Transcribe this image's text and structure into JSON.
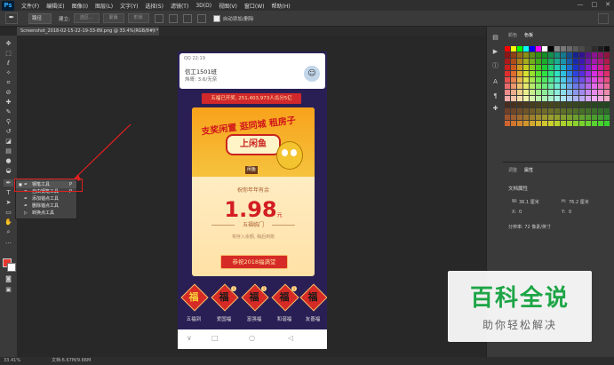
{
  "app": {
    "logo": "Ps"
  },
  "menubar": {
    "items": [
      "文件(F)",
      "编辑(E)",
      "图像(I)",
      "图层(L)",
      "文字(Y)",
      "选择(S)",
      "滤镜(T)",
      "3D(D)",
      "视图(V)",
      "窗口(W)",
      "帮助(H)"
    ],
    "window_controls": [
      "—",
      "□",
      "✕"
    ]
  },
  "optionsbar": {
    "mode": "路径",
    "make_label": "建立:",
    "selection_btn": "选区...",
    "mask_btn": "蒙版",
    "shape_btn": "形状",
    "auto_add_delete": "自动添加/删除"
  },
  "document": {
    "tab_title": "Screenshot_2018-02-15-22-19-33-89.png @ 33.4%(RGB/8#) *",
    "close": "×"
  },
  "status": {
    "zoom": "33.41%",
    "doc_info": "文档:6.67M/9.66M"
  },
  "context_menu": {
    "items": [
      {
        "label": "钢笔工具",
        "shortcut": "P",
        "selected": true
      },
      {
        "label": "自由钢笔工具",
        "shortcut": "P",
        "selected": false
      },
      {
        "label": "添加锚点工具",
        "shortcut": "",
        "selected": false
      },
      {
        "label": "删除锚点工具",
        "shortcut": "",
        "selected": false
      },
      {
        "label": "转换点工具",
        "shortcut": "",
        "selected": false
      }
    ]
  },
  "phone": {
    "notification": {
      "app": "QQ 22:19",
      "title": "信工1501班",
      "subtitle": "炜哥: 3.6/无奈"
    },
    "banner": "五福已开奖, 251,403,973人瓜分5亿",
    "card": {
      "slogan": "支奖闲置 逛同城 租房子",
      "brand": "上闲鱼",
      "logo": "闲鱼",
      "total_label": "祝你年年有余",
      "amount": "1.98",
      "amount_unit": "元",
      "subtitle": "五福临门",
      "note": "将存入余额, 稍后到账",
      "button": "恭祝2018福满堂"
    },
    "fu_cards": [
      {
        "char": "福",
        "name": "五福到",
        "gold": true
      },
      {
        "char": "福",
        "name": "爱国福",
        "gold": false
      },
      {
        "char": "福",
        "name": "富强福",
        "gold": false
      },
      {
        "char": "福",
        "name": "和谐福",
        "gold": false
      },
      {
        "char": "福",
        "name": "友善福",
        "gold": false
      }
    ],
    "fu_badge": "1",
    "nav": [
      "∨",
      "□",
      "○",
      "◁"
    ]
  },
  "panels": {
    "top_tabs": [
      "颜色",
      "色板"
    ],
    "bottom_tabs": [
      "调整",
      "属性"
    ],
    "prop_title": "文档属性",
    "props": [
      {
        "label": "W:",
        "value": "36.1 厘米"
      },
      {
        "label": "H:",
        "value": "76.2 厘米"
      },
      {
        "label": "X:",
        "value": "0"
      },
      {
        "label": "Y:",
        "value": "0"
      }
    ],
    "resolution": "分辨率: 72 像素/英寸"
  },
  "watermark": {
    "title": "百科全说",
    "subtitle": "助你轻松解决"
  },
  "colors": {
    "accent": "#e02020",
    "ps_blue": "#31a8ff",
    "brand_red": "#d52a25"
  }
}
